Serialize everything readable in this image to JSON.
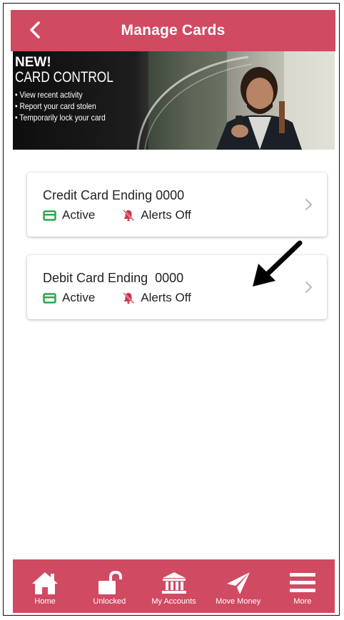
{
  "header": {
    "title": "Manage Cards",
    "back_icon": "chevron-left-icon"
  },
  "banner": {
    "new_label": "NEW!",
    "headline": "CARD CONTROL",
    "bullets": [
      "• View recent activity",
      "• Report your card stolen",
      "• Temporarily lock your card"
    ]
  },
  "cards": [
    {
      "title": "Credit Card Ending 0000",
      "status": "Active",
      "alerts": "Alerts Off"
    },
    {
      "title": "Debit Card Ending  0000",
      "status": "Active",
      "alerts": "Alerts Off"
    }
  ],
  "tabs": [
    {
      "label": "Home",
      "icon": "home-icon"
    },
    {
      "label": "Unlocked",
      "icon": "unlocked-icon"
    },
    {
      "label": "My Accounts",
      "icon": "bank-icon"
    },
    {
      "label": "Move Money",
      "icon": "send-icon"
    },
    {
      "label": "More",
      "icon": "menu-icon"
    }
  ],
  "colors": {
    "brand": "#d04a62",
    "status_green": "#2aa84a",
    "alert_red": "#d0304a"
  }
}
